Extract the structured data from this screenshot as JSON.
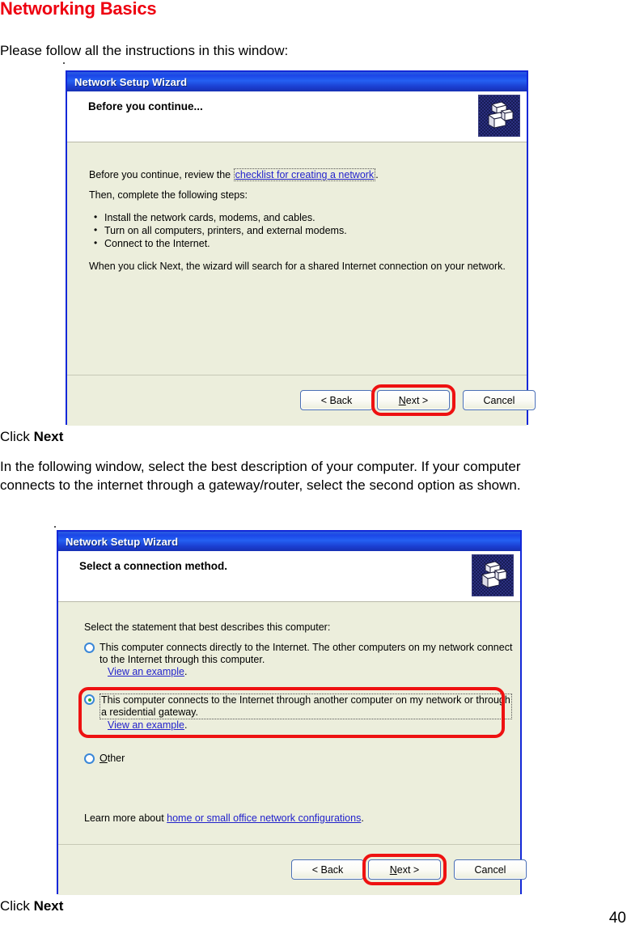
{
  "page": {
    "title": "Networking Basics",
    "intro": "Please follow all the instructions in this window:",
    "caption_after_first": "Click ",
    "caption_after_first_bold": "Next",
    "paragraph_line1": "In the following window, select the best description of your computer. If your computer",
    "paragraph_line2": "connects to the internet through a gateway/router, select the second option as shown.",
    "caption_after_second": "Click ",
    "caption_after_second_bold": "Next",
    "page_number": "40",
    "accent_red": "#ee0010",
    "highlight_red": "#ee1111",
    "link_blue": "#2222cc",
    "titlebar_blue": "#1b3fd2",
    "wizard_body": "#eceedc"
  },
  "wizard1": {
    "window_title": "Network Setup Wizard",
    "header_title": "Before you continue...",
    "icon_name": "network-computers-icon",
    "line1_before_link": "Before you continue, review the ",
    "line1_link": "checklist for creating a network",
    "line1_after_link": ".",
    "line2": "Then, complete the following steps:",
    "bullets": [
      "Install the network cards, modems, and cables.",
      "Turn on all computers, printers, and external modems.",
      "Connect to the Internet."
    ],
    "line3": "When you click Next, the wizard will search for a shared Internet connection on your network.",
    "buttons": {
      "back": "< Back",
      "next_pre": "N",
      "next_post": "ext >",
      "cancel": "Cancel"
    },
    "highlighted_button": "next-button"
  },
  "wizard2": {
    "window_title": "Network Setup Wizard",
    "header_title": "Select a connection method.",
    "icon_name": "network-computers-icon",
    "prompt": "Select the statement that best describes this computer:",
    "options": [
      {
        "id": "direct-connection",
        "selected": false,
        "line1": "This computer connects directly to the Internet. The other computers on my network connect",
        "line2": "to the Internet through this computer.",
        "example_link": "View an example",
        "example_link_suffix": "."
      },
      {
        "id": "gateway-connection",
        "selected": true,
        "line1": "This computer connects to the Internet through another computer on my network or through",
        "line2": "a residential gateway.",
        "example_link": "View an example",
        "example_link_suffix": "."
      },
      {
        "id": "other",
        "selected": false,
        "line1": "Other",
        "line2": "",
        "example_link": "",
        "example_link_suffix": ""
      }
    ],
    "learn_more_prefix": "Learn more about ",
    "learn_more_link": "home or small office network configurations",
    "learn_more_suffix": ".",
    "buttons": {
      "back": "< Back",
      "next_pre": "N",
      "next_post": "ext >",
      "cancel": "Cancel"
    },
    "highlighted_button": "next-button",
    "highlighted_option": "gateway-connection"
  }
}
